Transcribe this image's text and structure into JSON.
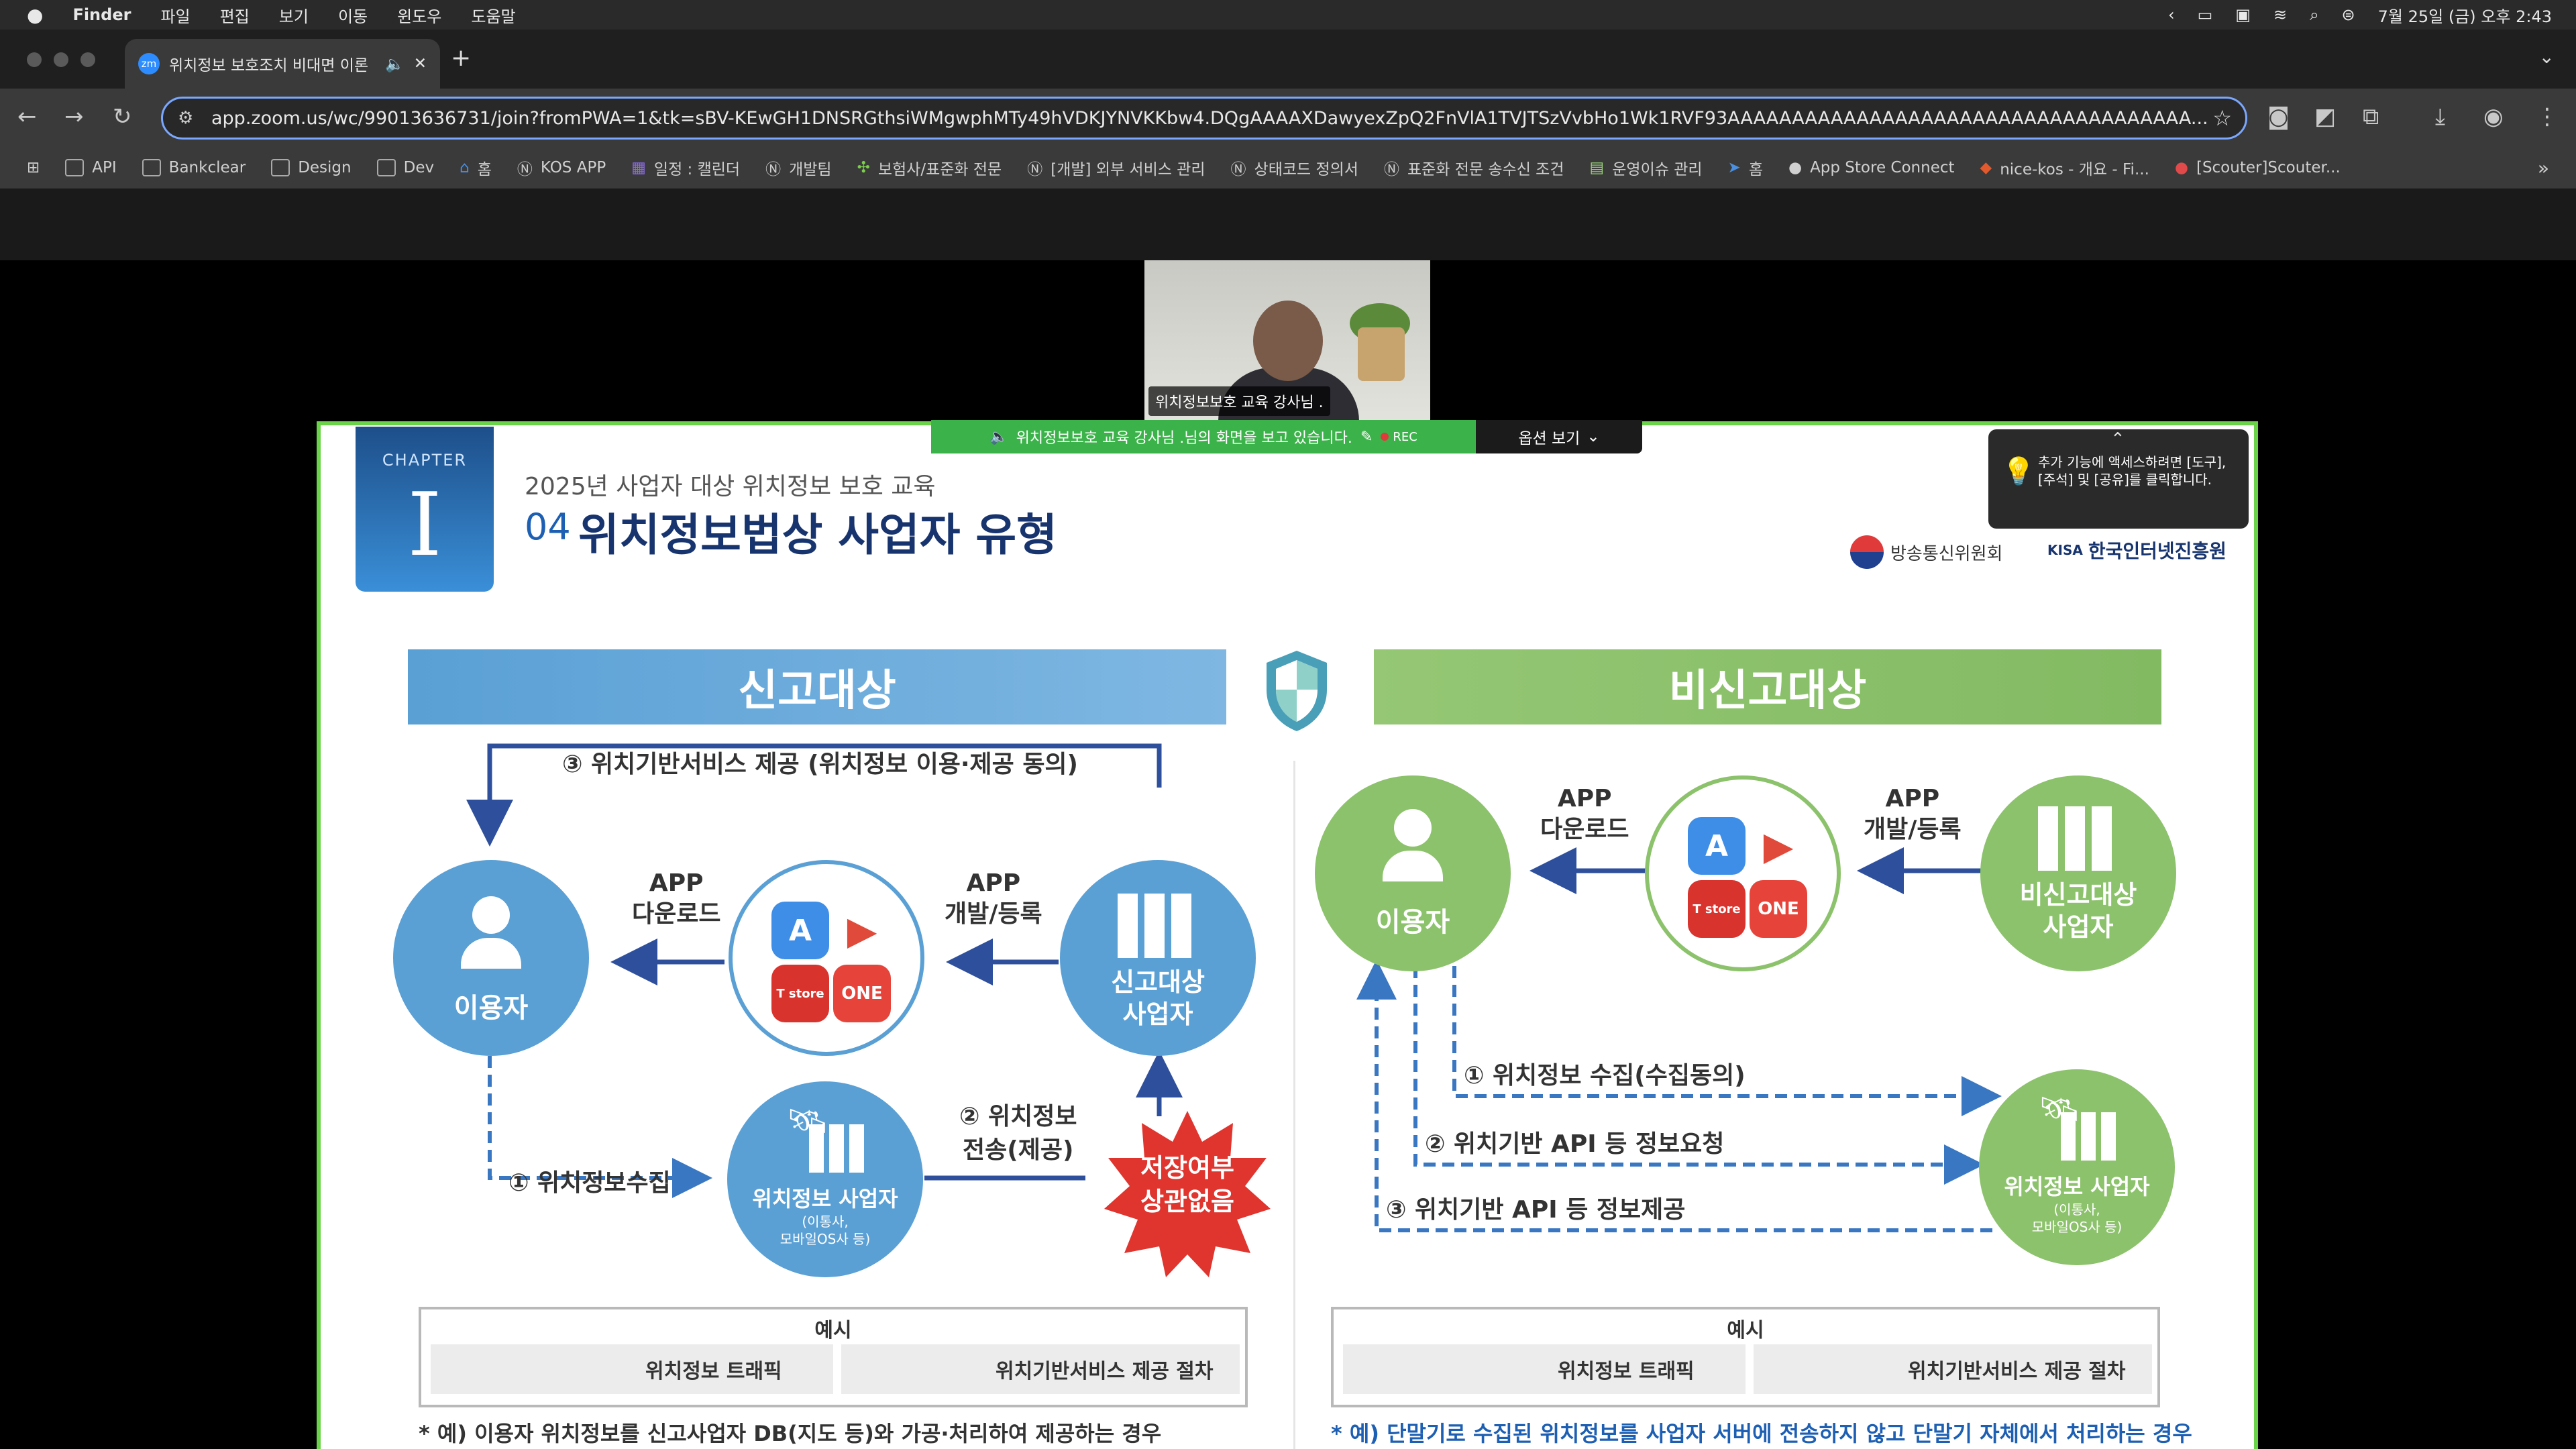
{
  "menubar": {
    "app": "Finder",
    "items": [
      "파일",
      "편집",
      "보기",
      "이동",
      "윈도우",
      "도움말"
    ],
    "datetime": "7월 25일 (금) 오후 2:43"
  },
  "browser": {
    "tab_title": "위치정보 보호조치 비대면 이론",
    "tab_favicon": "zm",
    "url": "app.zoom.us/wc/99013636731/join?fromPWA=1&tk=sBV-KEwGH1DNSRGthsiWMgwphMTy49hVDKJYNVKKbw4.DQgAAAAXDawyexZpQ2FnVlA1TVJTSzVvbHo1Wk1RVF93AAAAAAAAAAAAAAAAAAAAAAAAAAAAAAAAAAAA...",
    "bookmarks": [
      "API",
      "Bankclear",
      "Design",
      "Dev",
      "홈",
      "KOS APP",
      "일정 : 캘린더",
      "개발팀",
      "보험사/표준화 전문",
      "[개발] 외부 서비스 관리",
      "상태코드 정의서",
      "표준화 전문 송수신 조건",
      "운영이슈 관리",
      "홈",
      "App Store Connect",
      "nice-kos - 개요 - Fi...",
      "[Scouter]Scouter..."
    ]
  },
  "zoom": {
    "video_label": "위치정보보호 교육 강사님 .",
    "share_banner": "위치정보보호 교육 강사님 .님의 화면을 보고 있습니다.",
    "rec": "REC",
    "options_label": "옵션 보기",
    "tooltip": "추가 기능에 액세스하려면 [도구], [주석] 및 [공유]를 클릭합니다."
  },
  "slide": {
    "chapter_label": "CHAPTER",
    "chapter_num": "I",
    "subtitle": "2025년 사업자 대상 위치정보 보호 교육",
    "title_num": "04",
    "title": "위치정보법상 사업자 유형",
    "logo1": "방송통신위원회",
    "logo2_prefix": "KISA",
    "logo2": "한국인터넷진흥원",
    "left": {
      "header": "신고대상",
      "top_flow": "③ 위치기반서비스 제공 (위치정보 이용·제공 동의)",
      "user": "이용자",
      "app_download": [
        "APP",
        "다운로드"
      ],
      "app_dev": [
        "APP",
        "개발/등록"
      ],
      "provider": [
        "신고대상",
        "사업자"
      ],
      "loc_collect": "① 위치정보수집",
      "loc_transfer": [
        "② 위치정보",
        "전송(제공)"
      ],
      "loc_provider": "위치정보 사업자",
      "loc_provider_sub": [
        "(이통사,",
        "모바일OS사 등)"
      ],
      "storage": [
        "저장여부",
        "상관없음"
      ],
      "legend_title": "예시",
      "legend_a": "위치정보 트래픽",
      "legend_b": "위치기반서비스 제공 절차",
      "footnote": "* 예) 이용자 위치정보를 신고사업자 DB(지도 등)와 가공·처리하여 제공하는 경우"
    },
    "right": {
      "header": "비신고대상",
      "user": "이용자",
      "app_download": [
        "APP",
        "다운로드"
      ],
      "app_dev": [
        "APP",
        "개발/등록"
      ],
      "provider": [
        "비신고대상",
        "사업자"
      ],
      "step1": "① 위치정보 수집(수집동의)",
      "step2": "② 위치기반 API 등 정보요청",
      "step3": "③ 위치기반 API 등 정보제공",
      "loc_provider": "위치정보 사업자",
      "loc_provider_sub": [
        "(이통사,",
        "모바일OS사 등)"
      ],
      "legend_title": "예시",
      "legend_a": "위치정보 트래픽",
      "legend_b": "위치기반서비스 제공 절차",
      "footnote": "* 예) 단말기로 수집된 위치정보를 사업자 서버에 전송하지 않고 단말기 자체에서 처리하는 경우"
    },
    "colors": {
      "blue": "#6aa9d8",
      "green": "#8cc26b",
      "navy": "#2e4f9c",
      "red": "#e0342e"
    }
  }
}
